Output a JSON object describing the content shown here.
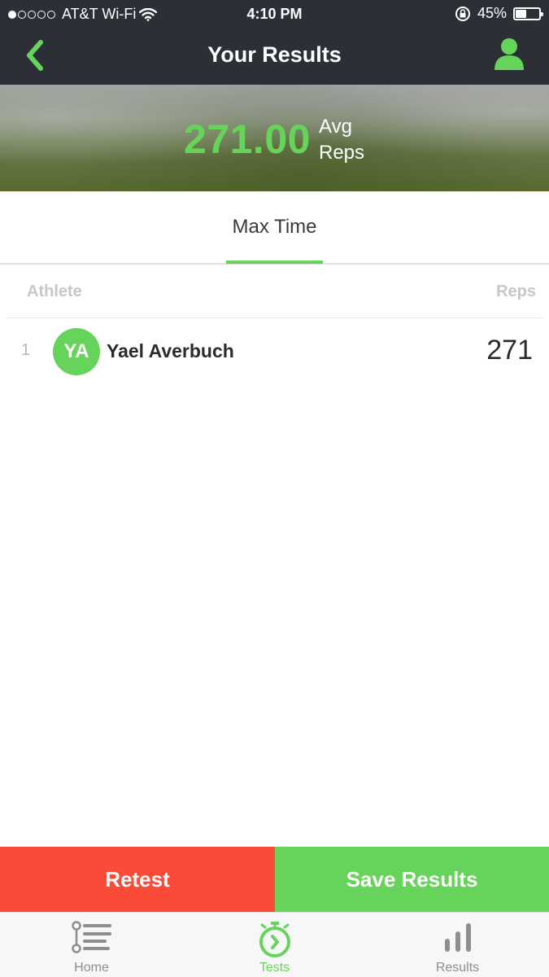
{
  "status_bar": {
    "carrier": "AT&T Wi-Fi",
    "time": "4:10 PM",
    "battery": "45%",
    "battery_level": 0.45,
    "signal_bars": 1
  },
  "nav": {
    "title": "Your Results",
    "back_icon": "chevron-left-icon",
    "profile_icon": "user-icon"
  },
  "summary": {
    "value": "271.00",
    "label_line1": "Avg",
    "label_line2": "Reps"
  },
  "tabs": [
    {
      "label": "Max Time",
      "active": true
    }
  ],
  "table": {
    "headers": {
      "athlete": "Athlete",
      "reps": "Reps"
    },
    "rows": [
      {
        "rank": "1",
        "initials": "YA",
        "name": "Yael Averbuch",
        "reps": "271"
      }
    ]
  },
  "actions": {
    "retest_label": "Retest",
    "save_label": "Save Results"
  },
  "tab_bar": {
    "items": [
      {
        "label": "Home",
        "icon": "list-icon",
        "active": false
      },
      {
        "label": "Tests",
        "icon": "stopwatch-icon",
        "active": true
      },
      {
        "label": "Results",
        "icon": "bar-chart-icon",
        "active": false
      }
    ]
  },
  "colors": {
    "accent_green": "#66d45a",
    "retest_red": "#fa4a38",
    "header_dark": "#2c2f35"
  }
}
